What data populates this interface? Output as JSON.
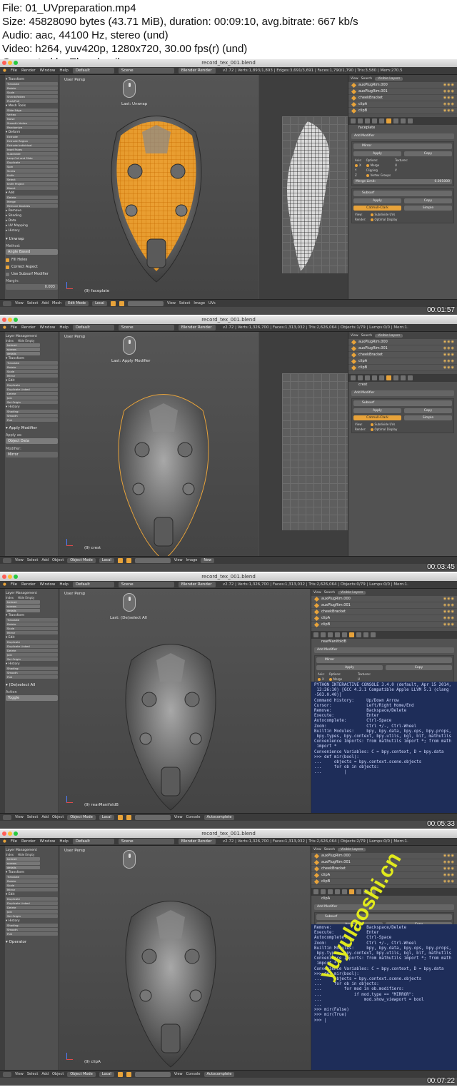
{
  "header": {
    "file": "File: 01_UVpreparation.mp4",
    "size": "Size: 45828090 bytes (43.71 MiB), duration: 00:09:10, avg.bitrate: 667 kb/s",
    "audio": "Audio: aac, 44100 Hz, stereo (und)",
    "video": "Video: h264, yuv420p, 1280x720, 30.00 fps(r) (und)",
    "generated": "Generated by Thumbnail me"
  },
  "menu": {
    "file": "File",
    "render": "Render",
    "window": "Window",
    "help": "Help",
    "layout": "Default",
    "scene": "Scene",
    "engine": "Blender Render"
  },
  "colors": {
    "accent": "#e8a33a",
    "console_bg": "#1e2d59",
    "watermark": "#e9f21a"
  },
  "frames": [
    {
      "window_title": "record_tex_001.blend",
      "stats": "v2.72 | Verts:1,893/1,893 | Edges:3,691/3,691 | Faces:1,790/1,790 | Tris:3,580 | Mem:270.5",
      "view_label": "User Persp",
      "last_op": "Last: Unwrap",
      "object_label": "(9) faceplate",
      "timestamp": "00:01:57",
      "tool_panels": [
        "Transform",
        "Mesh Tools",
        "Deform",
        "Add",
        "Remove",
        "Shading",
        "Data",
        "UV Mapping",
        "History"
      ],
      "tool_buttons": [
        "Translate",
        "Rotate",
        "Scale",
        "Shrink/Fatten",
        "Push/Pull",
        "Slide Edge",
        "Vertex",
        "Noise",
        "Smooth Vertex",
        "Randomize",
        "Extrude",
        "Extrude Region",
        "Extrude Individual",
        "Inset Faces",
        "Subdivide",
        "Loop Cut and Slide",
        "Duplicate",
        "Spin",
        "Screw",
        "Knife",
        "Select",
        "Knife Project",
        "Bisect",
        "Delete",
        "Merge",
        "Remove Doubles"
      ],
      "operator": {
        "name": "Unwrap",
        "method_label": "Method:",
        "method": "Angle Based",
        "fill_holes": "Fill Holes",
        "correct_aspect": "Correct Aspect",
        "use_subsurf": "Use Subsurf Modifier",
        "margin_label": "Margin:",
        "margin": "0.003"
      },
      "outliner": [
        "auxPlugRim.000",
        "auxPlugRim.001",
        "cheekBracket",
        "clipA",
        "clipB"
      ],
      "outliner_tabs": {
        "view": "View",
        "search": "Search",
        "visible": "Visible Layers"
      },
      "prop_object": "faceplate",
      "add_modifier": "Add Modifier",
      "modifiers": [
        {
          "name": "Mirror",
          "apply": "Apply",
          "copy": "Copy",
          "axis": "Axis:",
          "options": "Options:",
          "textures": "Textures:",
          "x": "X",
          "y": "Y",
          "z": "Z",
          "merge": "Merge",
          "clipping": "Clipping",
          "vgroups": "Vertex Groups",
          "u": "U",
          "v": "V",
          "merge_limit": "Merge Limit:",
          "merge_value": "0.001000"
        },
        {
          "name": "Subsurf",
          "apply": "Apply",
          "copy": "Copy",
          "catmull": "Catmull-Clark",
          "simple": "Simple",
          "view": "View:",
          "render": "Render:",
          "subdiv_uvs": "Subdivide UVs",
          "optimal": "Optimal Display"
        }
      ],
      "bottom": [
        "View",
        "Select",
        "Add",
        "Mesh",
        "Edit Mode",
        "Local",
        "View",
        "Select",
        "Image",
        "UVs"
      ]
    },
    {
      "window_title": "record_tex_001.blend",
      "stats": "v2.72 | Verts:1,326,700 | Faces:1,313,032 | Tris:2,626,064 | Objects:1/79 | Lamps:0/0 | Mem:1.",
      "view_label": "User Persp",
      "last_op": "Last: Apply Modifier",
      "object_label": "(9) crest",
      "timestamp": "00:03:45",
      "layer_mgmt": {
        "title": "Layer Management",
        "index": "Index",
        "hide_empty": "Hide Empty",
        "rows": [
          "helmet",
          "screws",
          "details"
        ]
      },
      "tool_panels": [
        "Transform",
        "Edit",
        "History"
      ],
      "tool_buttons": [
        "Translate",
        "Rotate",
        "Scale",
        "Mirror",
        "Duplicate",
        "Duplicate Linked",
        "Delete",
        "Join",
        "Set Origin",
        "Shading:",
        "Smooth",
        "Flat"
      ],
      "operator": {
        "name": "Apply Modifier",
        "apply_as_label": "Apply as:",
        "apply_as": "Object Data",
        "modifier_label": "Modifier:",
        "modifier": "Mirror"
      },
      "outliner": [
        "auxPlugRim.000",
        "auxPlugRim.001",
        "cheekBracket",
        "clipA",
        "clipB"
      ],
      "prop_object": "crest",
      "add_modifier": "Add Modifier",
      "modifiers": [
        {
          "name": "Subsurf",
          "apply": "Apply",
          "copy": "Copy",
          "catmull": "Catmull-Clark",
          "simple": "Simple",
          "view": "View:",
          "render": "Render:",
          "subdiv_uvs": "Subdivide UVs",
          "optimal": "Optimal Display"
        }
      ],
      "bottom": [
        "View",
        "Select",
        "Add",
        "Object",
        "Object Mode",
        "Local",
        "View",
        "Image",
        "New"
      ]
    },
    {
      "window_title": "record_tex_001.blend",
      "stats": "v2.72 | Verts:1,326,700 | Faces:1,313,032 | Tris:2,626,064 | Objects:0/79 | Lamps:0/0 | Mem:1.",
      "view_label": "User Persp",
      "last_op": "Last: (De)select All",
      "object_label": "(9) rearManifoldB",
      "timestamp": "00:05:33",
      "layer_mgmt": {
        "title": "Layer Management",
        "index": "Index",
        "hide_empty": "Hide Empty",
        "rows": [
          "helmet",
          "screws",
          "details"
        ]
      },
      "tool_panels": [
        "Transform",
        "Edit",
        "History"
      ],
      "tool_buttons": [
        "Translate",
        "Rotate",
        "Scale",
        "Mirror",
        "Duplicate",
        "Duplicate Linked",
        "Delete",
        "Join",
        "Set Origin",
        "Shading:",
        "Smooth",
        "Flat"
      ],
      "operator": {
        "name": "(De)select All",
        "action_label": "Action",
        "action": "Toggle"
      },
      "outliner": [
        "auxPlugRim.000",
        "auxPlugRim.001",
        "cheekBracket",
        "clipA",
        "clipB"
      ],
      "prop_object": "rearManifoldB",
      "add_modifier": "Add Modifier",
      "modifiers": [
        {
          "name": "Mirror",
          "apply": "Apply",
          "copy": "Copy",
          "axis": "Axis:",
          "options": "Options:",
          "textures": "Textures:",
          "x": "X",
          "y": "Y",
          "z": "Z",
          "merge": "Merge",
          "clipping": "Clipping",
          "vgroups": "Vertex Groups",
          "u": "U",
          "v": "V",
          "merge_limit": "Merge Limit:",
          "merge_value": "0.001000"
        }
      ],
      "console": [
        "PYTHON INTERACTIVE CONSOLE 3.4.0 (default, Apr 15 2014,",
        " 12:26:10) [GCC 4.2.1 Compatible Apple LLVM 5.1 (clang",
        "-503.0.40)]",
        "",
        "Command History:     Up/Down Arrow",
        "Cursor:              Left/Right Home/End",
        "Remove:              Backspace/Delete",
        "Execute:             Enter",
        "Autocomplete:        Ctrl-Space",
        "Zoom:                Ctrl +/-, Ctrl-Wheel",
        "Builtin Modules:     bpy, bpy.data, bpy.ops, bpy.props,",
        " bpy.types, bpy.context, bpy.utils, bgl, blf, mathutils",
        "Convenience Imports: from mathutils import *; from math",
        " import *",
        "Convenience Variables: C = bpy.context, D = bpy.data",
        "",
        ">>> def mir(bool):",
        "...     objects = bpy.context.scene.objects",
        "...     for ob in objects:",
        "...         |"
      ],
      "bottom": [
        "View",
        "Select",
        "Add",
        "Object",
        "Object Mode",
        "Local",
        "View",
        "Console",
        "Autocomplete"
      ]
    },
    {
      "window_title": "record_tex_001.blend",
      "stats": "v2.72 | Verts:1,326,700 | Faces:1,313,032 | Tris:2,626,064 | Objects:2/79 | Lamps:0/0 | Mem:1.",
      "view_label": "User Persp",
      "last_op": "",
      "object_label": "(9) clipA",
      "timestamp": "00:07:22",
      "layer_mgmt": {
        "title": "Layer Management",
        "index": "Index",
        "hide_empty": "Hide Empty",
        "rows": [
          "helmet",
          "screws",
          "details"
        ]
      },
      "tool_panels": [
        "Transform",
        "Edit",
        "History"
      ],
      "tool_buttons": [
        "Translate",
        "Rotate",
        "Scale",
        "Mirror",
        "Duplicate",
        "Duplicate Linked",
        "Delete",
        "Join",
        "Set Origin",
        "Shading:",
        "Smooth",
        "Flat"
      ],
      "operator": {
        "name": "Operator"
      },
      "outliner": [
        "auxPlugRim.000",
        "auxPlugRim.001",
        "cheekBracket",
        "clipA",
        "clipB"
      ],
      "prop_object": "clipA",
      "add_modifier": "Add Modifier",
      "modifiers": [
        {
          "name": "Subsurf",
          "apply": "Apply",
          "copy": "Copy",
          "catmull": "Catmull-Clark",
          "simple": "Simple",
          "view": "View:",
          "render": "Render:",
          "subdiv_uvs": "Subdivide UVs",
          "optimal": "Optimal Display"
        }
      ],
      "console": [
        "Remove:              Backspace/Delete",
        "Execute:             Enter",
        "Autocomplete:        Ctrl-Space",
        "Zoom:                Ctrl +/-, Ctrl-Wheel",
        "Builtin Modules:     bpy, bpy.data, bpy.ops, bpy.props,",
        " bpy.types, bpy.context, bpy.utils, bgl, blf, mathutils",
        "Convenience Imports: from mathutils import *; from math",
        " import *",
        "Convenience Variables: C = bpy.context, D = bpy.data",
        "",
        ">>> def mir(bool):",
        "...     objects = bpy.context.scene.objects",
        "...     for ob in objects:",
        "...         for mod in ob.modifiers:",
        "...             if mod.type == \"MIRROR\":",
        "...                 mod.show_viewport = bool",
        "...",
        ">>> mir(False)",
        ">>> mir(True)",
        ">>> |"
      ],
      "bottom": [
        "View",
        "Select",
        "Add",
        "Object",
        "Object Mode",
        "Local",
        "View",
        "Console",
        "Autocomplete"
      ]
    }
  ],
  "watermark": "yuyulaoshi.cn"
}
